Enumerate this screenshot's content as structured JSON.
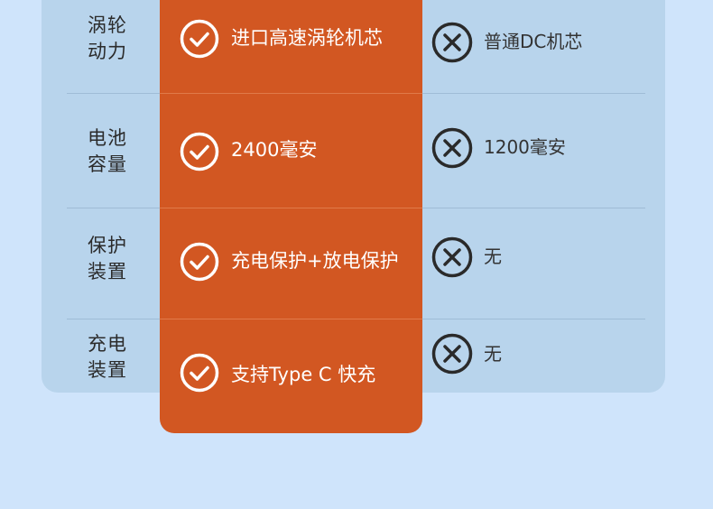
{
  "rows": [
    {
      "label_line1": "涡轮",
      "label_line2": "动力",
      "ours": "进口高速涡轮机芯",
      "theirs": "普通DC机芯"
    },
    {
      "label_line1": "电池",
      "label_line2": "容量",
      "ours": "2400毫安",
      "theirs": "1200毫安"
    },
    {
      "label_line1": "保护",
      "label_line2": "装置",
      "ours": "充电保护+放电保护",
      "theirs": "无"
    },
    {
      "label_line1": "充电",
      "label_line2": "装置",
      "ours": "支持Type C  快充",
      "theirs": "无"
    }
  ],
  "colors": {
    "background": "#cfe4fb",
    "panel": "#b8d4ec",
    "highlight": "#d25722",
    "check": "#ffffff",
    "cross": "#2a2a2a"
  },
  "icons": {
    "ours": "check-circle-icon",
    "theirs": "x-circle-icon"
  }
}
